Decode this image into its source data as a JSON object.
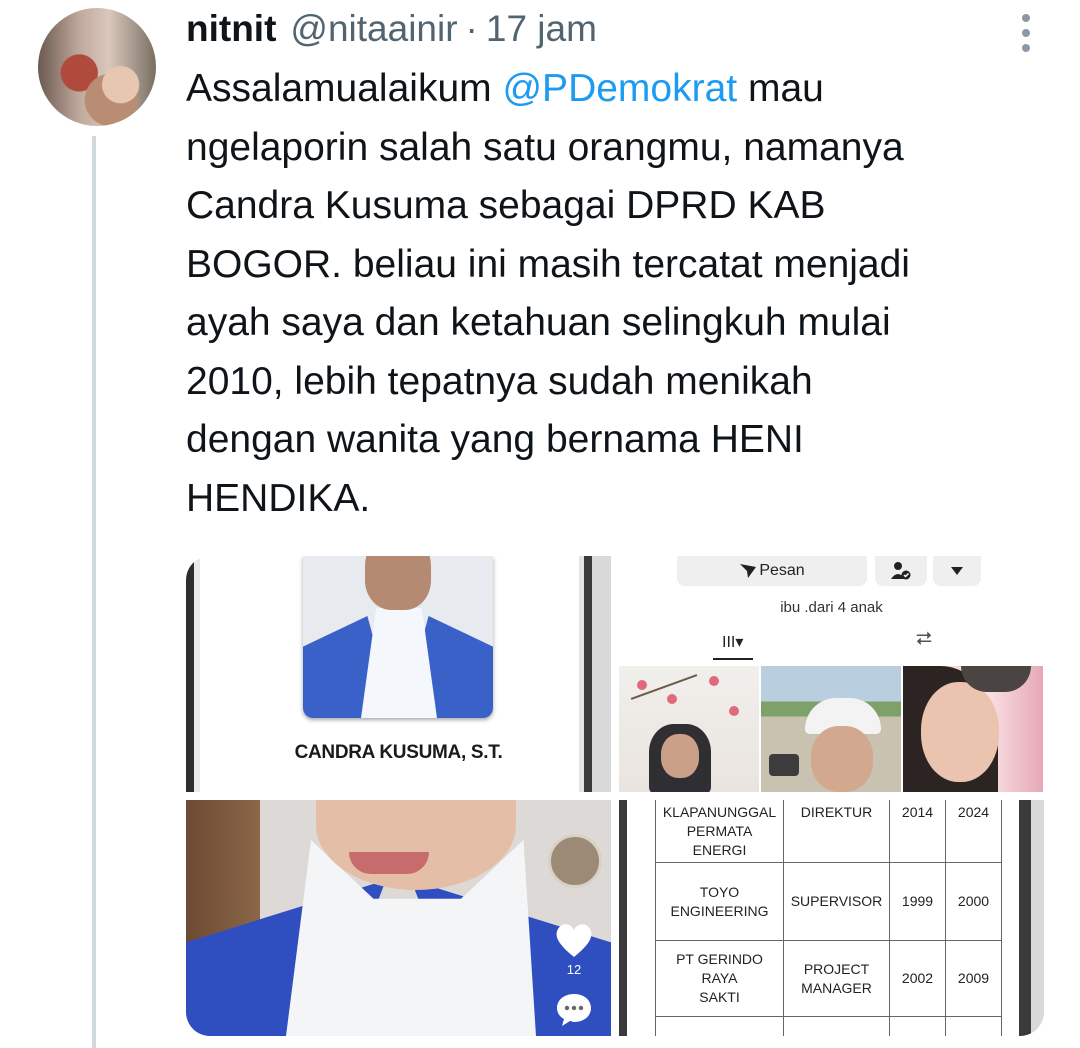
{
  "tweet": {
    "display_name": "nitnit",
    "handle": "@nitaainir",
    "separator": "·",
    "time": "17 jam",
    "text_before": "Assalamualaikum ",
    "mention": "@PDemokrat",
    "text_after": " mau\nngelaporin salah satu orangmu, namanya\nCandra Kusuma sebagai DPRD KAB\nBOGOR. beliau ini masih tercatat menjadi\nayah saya dan ketahuan selingkuh mulai\n2010, lebih tepatnya sudah menikah\ndengan wanita yang bernama HENI\nHENDIKA."
  },
  "media": {
    "image1": {
      "caption": "CANDRA KUSUMA, S.T."
    },
    "image2": {
      "message_button": "Pesan",
      "bio": "ibu .dari 4 anak",
      "grid_tab_glyph": "III▾",
      "repost_tab_glyph": "⮂"
    },
    "image3": {
      "like_count": "12"
    },
    "image4": {
      "rows": [
        {
          "company": "KLAPANUNGGAL\nPERMATA ENERGI",
          "role": "DIREKTUR",
          "start": "2014",
          "end": "2024"
        },
        {
          "company": "TOYO\nENGINEERING",
          "role": "SUPERVISOR",
          "start": "1999",
          "end": "2000"
        },
        {
          "company": "PT GERINDO RAYA\nSAKTI",
          "role": "PROJECT\nMANAGER",
          "start": "2002",
          "end": "2009"
        }
      ]
    }
  },
  "colors": {
    "link": "#1d9bf0",
    "secondary_text": "#536471",
    "thread_line": "#cfd9de"
  },
  "icons": [
    "more-options-icon",
    "send-icon",
    "user-check-icon",
    "chevron-down-icon",
    "grid-icon",
    "repost-icon",
    "heart-icon",
    "comment-icon"
  ]
}
